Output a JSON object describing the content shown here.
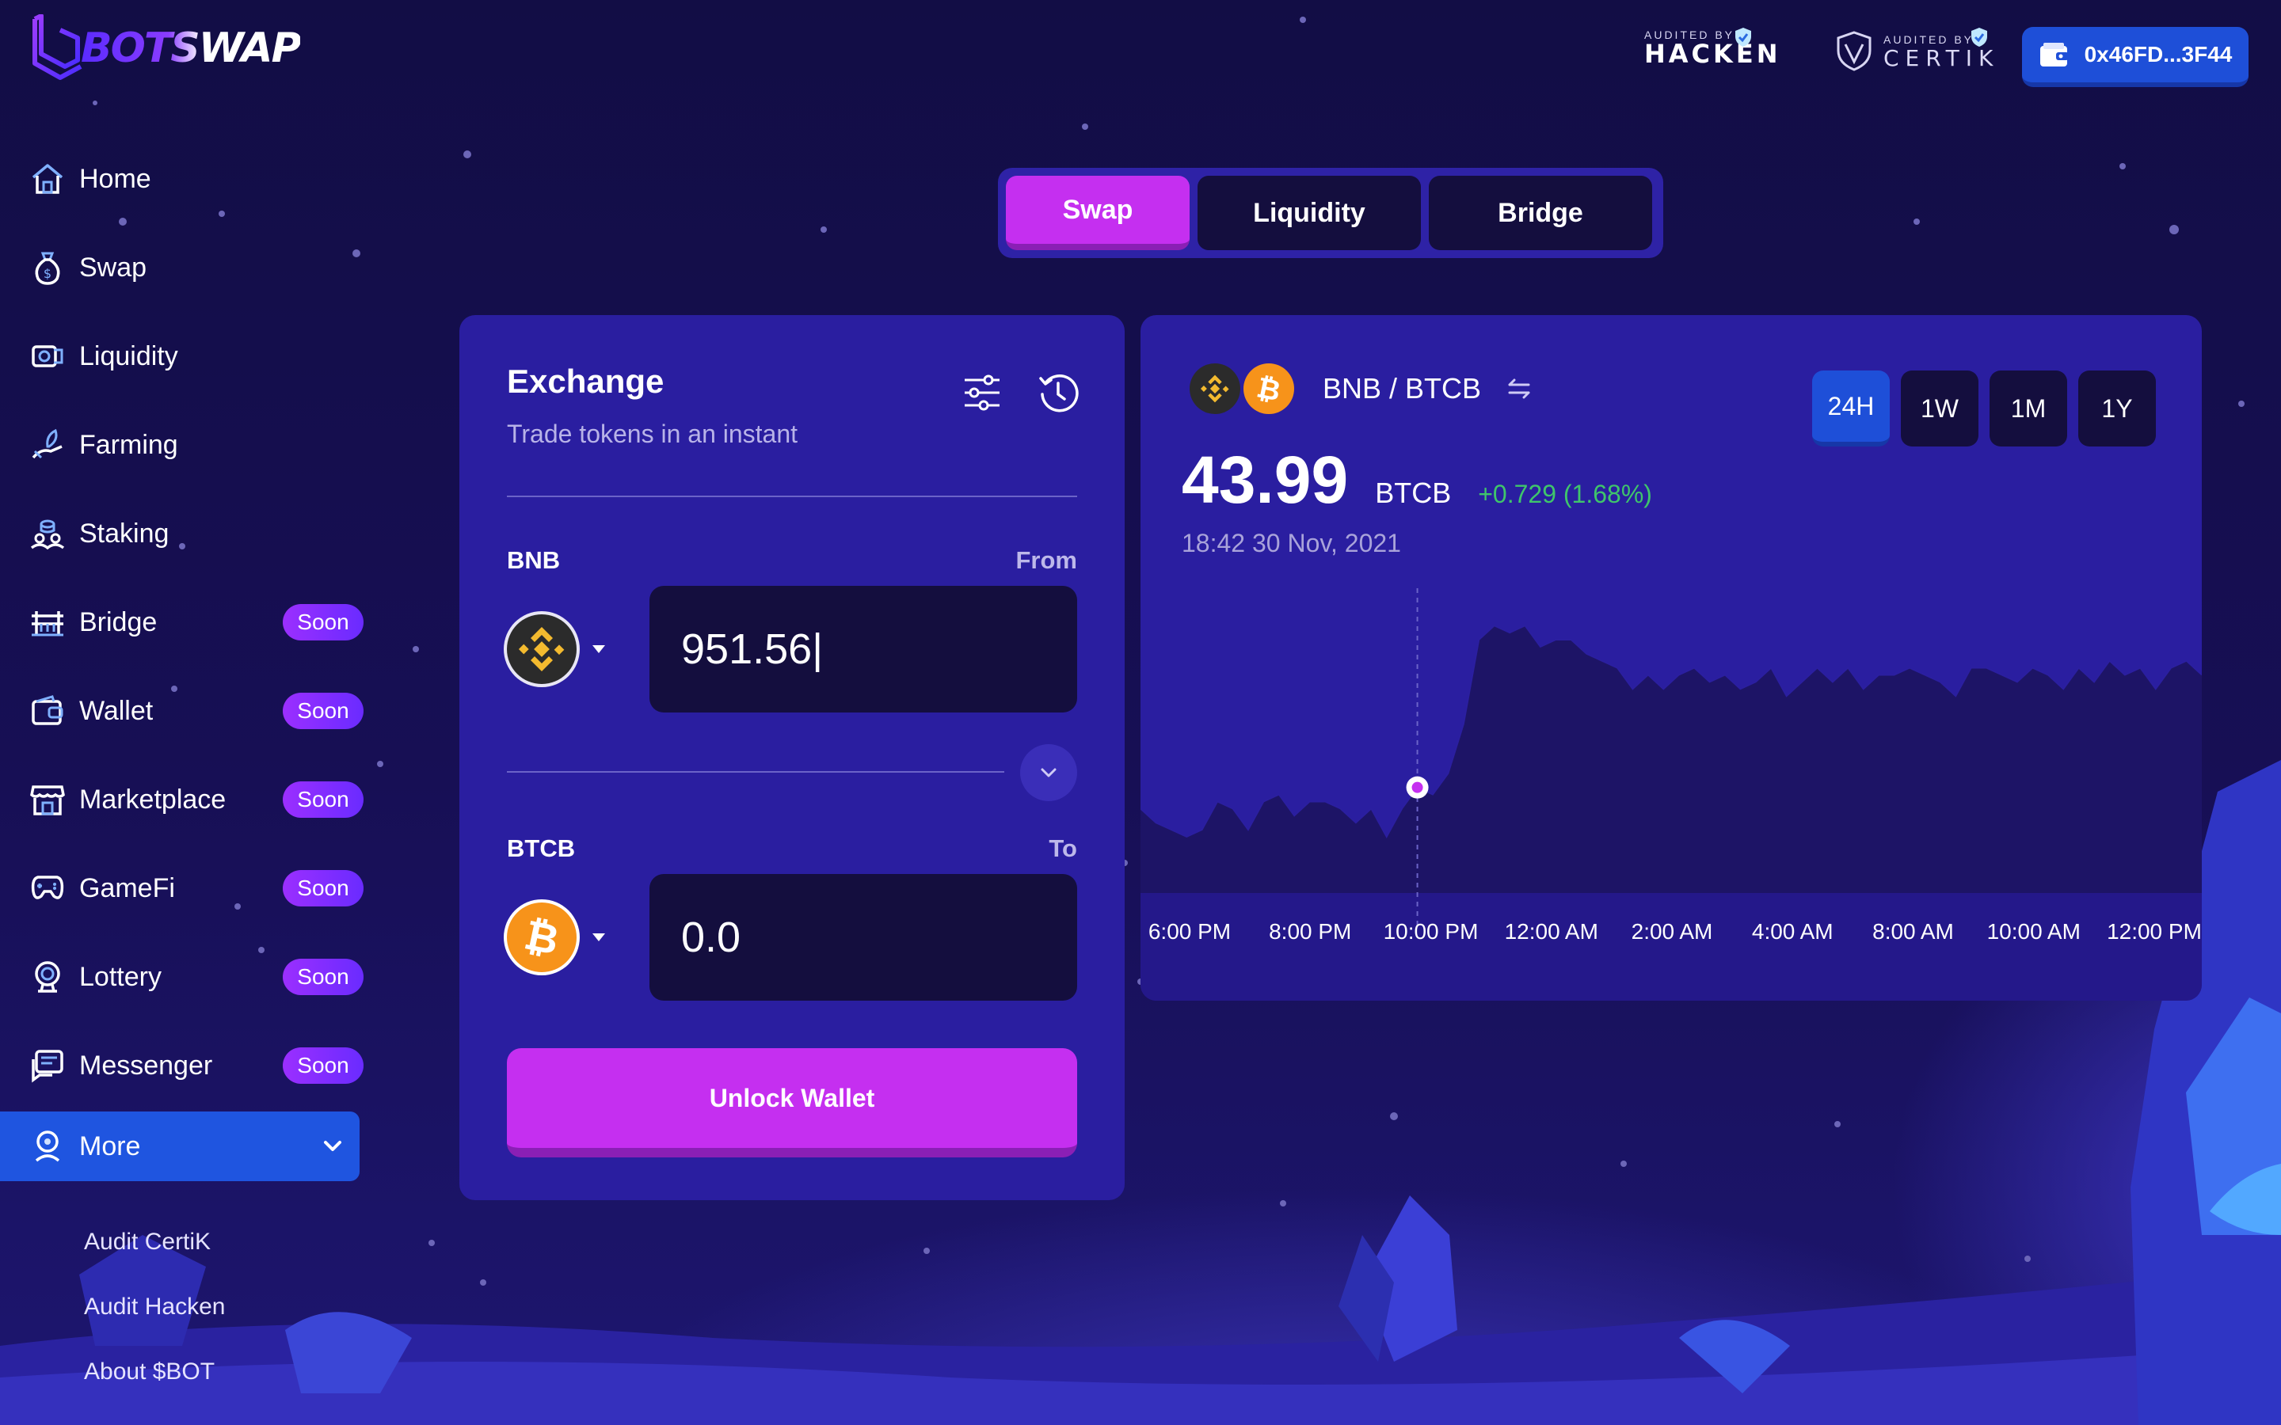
{
  "brand": {
    "name": "BOTSWAP"
  },
  "header": {
    "audit_hacken": {
      "small": "AUDITED BY",
      "name": "HACKEN"
    },
    "audit_certik": {
      "small": "AUDITED BY",
      "name": "CERTIK"
    },
    "wallet_address": "0x46FD...3F44"
  },
  "sidebar": {
    "items": [
      {
        "label": "Home",
        "icon": "home-icon",
        "badge": ""
      },
      {
        "label": "Swap",
        "icon": "money-bag-icon",
        "badge": ""
      },
      {
        "label": "Liquidity",
        "icon": "liquidity-icon",
        "badge": ""
      },
      {
        "label": "Farming",
        "icon": "farming-icon",
        "badge": ""
      },
      {
        "label": "Staking",
        "icon": "staking-icon",
        "badge": ""
      },
      {
        "label": "Bridge",
        "icon": "bridge-icon",
        "badge": "Soon"
      },
      {
        "label": "Wallet",
        "icon": "wallet-icon",
        "badge": "Soon"
      },
      {
        "label": "Marketplace",
        "icon": "store-icon",
        "badge": "Soon"
      },
      {
        "label": "GameFi",
        "icon": "gamepad-icon",
        "badge": "Soon"
      },
      {
        "label": "Lottery",
        "icon": "lottery-icon",
        "badge": "Soon"
      },
      {
        "label": "Messenger",
        "icon": "chat-icon",
        "badge": "Soon"
      }
    ],
    "more": {
      "label": "More",
      "expanded": true
    },
    "sub_items": [
      "Audit CertiK",
      "Audit Hacken",
      "About $BOT"
    ]
  },
  "tabs": [
    {
      "label": "Swap",
      "active": true
    },
    {
      "label": "Liquidity",
      "active": false
    },
    {
      "label": "Bridge",
      "active": false
    }
  ],
  "exchange": {
    "title": "Exchange",
    "subtitle": "Trade tokens in an instant",
    "from": {
      "token": "BNB",
      "side_label": "From",
      "amount": "951.56|"
    },
    "to": {
      "token": "BTCB",
      "side_label": "To",
      "amount": "0.0"
    },
    "unlock_label": "Unlock Wallet"
  },
  "price_panel": {
    "pair": "BNB / BTCB",
    "price": "43.99",
    "unit": "BTCB",
    "change": "+0.729 (1.68%)",
    "timestamp": "18:42 30 Nov, 2021",
    "ranges": [
      {
        "label": "24H",
        "active": true
      },
      {
        "label": "1W",
        "active": false
      },
      {
        "label": "1M",
        "active": false
      },
      {
        "label": "1Y",
        "active": false
      }
    ]
  },
  "colors": {
    "accent_purple": "#c52ff0",
    "accent_blue": "#1e4fd8",
    "panel": "#2a1ea0",
    "positive": "#3fc56b"
  },
  "chart_data": {
    "type": "area",
    "x_labels": [
      "6:00 PM",
      "8:00 PM",
      "10:00 PM",
      "12:00 AM",
      "2:00 AM",
      "4:00 AM",
      "8:00 AM",
      "10:00 AM",
      "12:00 PM"
    ],
    "values": [
      42.2,
      42.0,
      41.9,
      41.8,
      41.9,
      42.3,
      42.2,
      41.9,
      42.3,
      42.4,
      42.1,
      42.3,
      42.3,
      42.2,
      42.0,
      42.2,
      41.8,
      42.2,
      42.5,
      42.4,
      42.7,
      43.4,
      44.6,
      44.8,
      44.7,
      44.8,
      44.5,
      44.6,
      44.6,
      44.4,
      44.3,
      44.2,
      43.9,
      44.1,
      43.9,
      44.1,
      44.2,
      44.0,
      44.1,
      43.9,
      44.0,
      44.2,
      43.8,
      44.0,
      44.2,
      44.0,
      44.2,
      43.9,
      44.1,
      44.1,
      44.2,
      44.1,
      44.0,
      43.8,
      44.2,
      44.2,
      44.1,
      44.0,
      44.2,
      44.1,
      43.9,
      44.2,
      44.0,
      44.3,
      44.1,
      44.2,
      43.9,
      44.2,
      44.3,
      44.1
    ],
    "y_range": [
      41.0,
      45.5
    ],
    "highlight_index": 18,
    "grid": false
  }
}
